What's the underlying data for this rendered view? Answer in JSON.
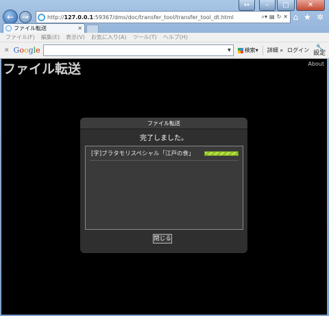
{
  "browser": {
    "url_prefix": "http://",
    "url_host": "127.0.0.1",
    "url_rest": ":59367/dms/doc/transfer_tool/transfer_tool_dt.html",
    "tab_title": "ファイル転送",
    "menu": [
      "ファイル(F)",
      "編集(E)",
      "表示(V)",
      "お気に入り(A)",
      "ツール(T)",
      "ヘルプ(H)"
    ],
    "toolbar": {
      "google_letters": [
        "G",
        "o",
        "o",
        "g",
        "l",
        "e"
      ],
      "search_label": "検索",
      "details_label": "詳細 »",
      "login_label": "ログイン",
      "settings_label": "設定"
    }
  },
  "page": {
    "title": "ファイル転送",
    "about_link": "About"
  },
  "dialog": {
    "title": "ファイル転送",
    "message": "完了しました。",
    "items": [
      {
        "label": "[字]ブラタモリスペシャル「江戸の食」",
        "progress": 1.0
      }
    ],
    "close_button": "閉じる"
  }
}
